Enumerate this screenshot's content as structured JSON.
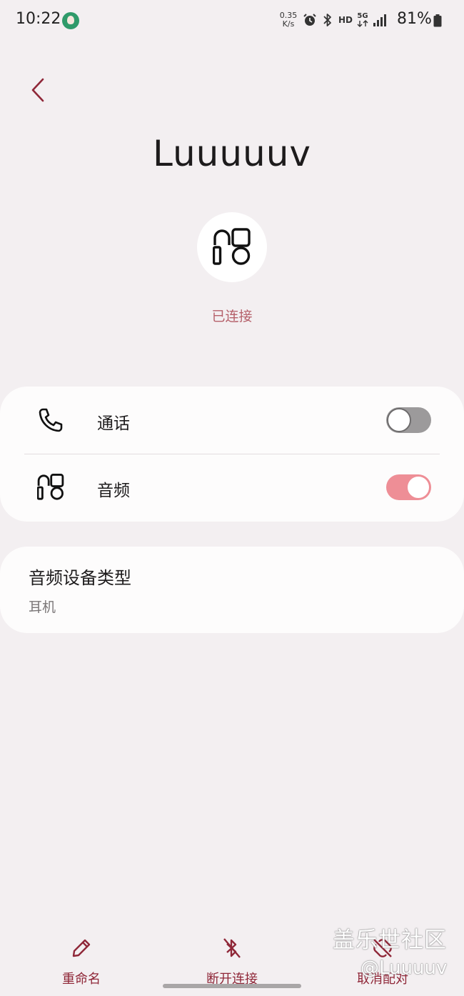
{
  "status_bar": {
    "time": "10:22",
    "net_speed_value": "0.35",
    "net_speed_unit": "K/s",
    "hd_label": "HD",
    "network_type": "5G",
    "battery_percent": "81%"
  },
  "header": {
    "device_name": "Luuuuuv",
    "connection_status": "已连接"
  },
  "profiles": [
    {
      "label": "通话",
      "icon": "phone-icon",
      "enabled": false
    },
    {
      "label": "音频",
      "icon": "audio-device-icon",
      "enabled": true
    }
  ],
  "audio_type": {
    "title": "音频设备类型",
    "value": "耳机"
  },
  "bottom_actions": [
    {
      "label": "重命名",
      "icon": "pencil-icon"
    },
    {
      "label": "断开连接",
      "icon": "bluetooth-off-icon"
    },
    {
      "label": "取消配对",
      "icon": "unpair-icon"
    }
  ],
  "watermark": {
    "text": "盖乐世社区",
    "user": "@Luuuuv"
  },
  "colors": {
    "accent": "#8f2738",
    "status_text": "#b5606a",
    "toggle_on": "#ee8e96",
    "toggle_off": "#9c9a9b",
    "background": "#f3eff1",
    "card": "#fdfcfc"
  }
}
